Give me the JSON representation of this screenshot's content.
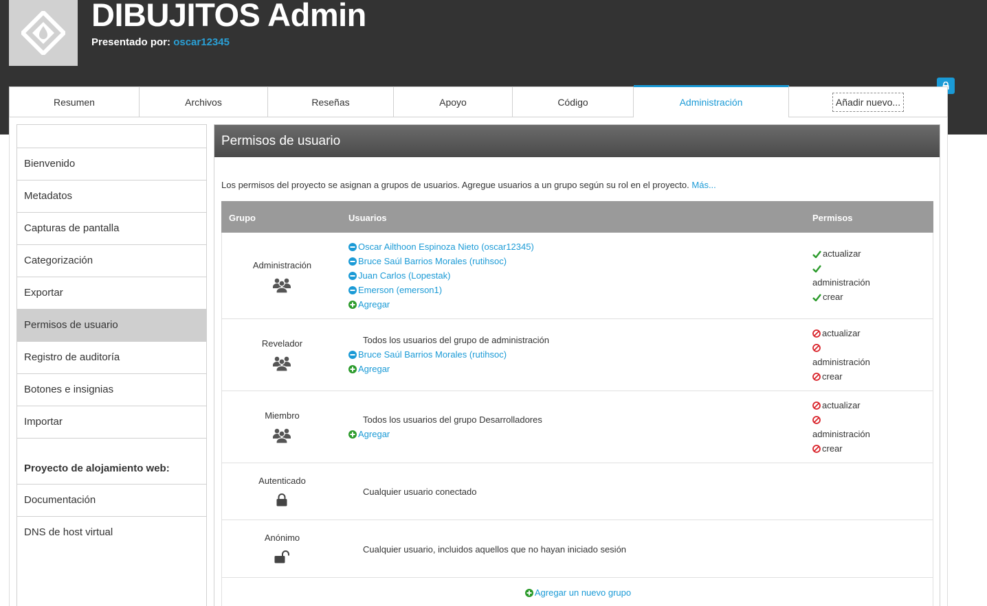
{
  "header": {
    "title": "DIBUJITOS Admin",
    "byline_label": "Presentado por:",
    "byline_user": "oscar12345"
  },
  "tabs": [
    {
      "label": "Resumen"
    },
    {
      "label": "Archivos"
    },
    {
      "label": "Reseñas"
    },
    {
      "label": "Apoyo"
    },
    {
      "label": "Código"
    },
    {
      "label": "Administración"
    },
    {
      "label": "Añadir nuevo..."
    }
  ],
  "sidebar": {
    "items": [
      {
        "label": "Bienvenido"
      },
      {
        "label": "Metadatos"
      },
      {
        "label": "Capturas de pantalla"
      },
      {
        "label": "Categorización"
      },
      {
        "label": "Exportar"
      },
      {
        "label": "Permisos de usuario"
      },
      {
        "label": "Registro de auditoría"
      },
      {
        "label": "Botones e insignias"
      },
      {
        "label": "Importar"
      }
    ],
    "section_heading": "Proyecto de alojamiento web:",
    "section_items": [
      {
        "label": "Documentación"
      },
      {
        "label": "DNS de host virtual"
      }
    ]
  },
  "main": {
    "title": "Permisos de usuario",
    "intro": "Los permisos del proyecto se asignan a grupos de usuarios. Agregue usuarios a un grupo según su rol en el proyecto.",
    "intro_link": "Más...",
    "columns": {
      "group": "Grupo",
      "users": "Usuarios",
      "perms": "Permisos"
    },
    "add_label": "Agregar",
    "perm_labels": {
      "update": "actualizar",
      "admin": "administración",
      "create": "crear"
    },
    "groups": [
      {
        "name": "Administración",
        "users": [
          "Oscar Ailthoon Espinoza Nieto (oscar12345)",
          "Bruce Saúl Barrios Morales (rutihsoc)",
          "Juan Carlos (Lopestak)",
          "Emerson (emerson1)"
        ]
      },
      {
        "name": "Revelador",
        "note": "Todos los usuarios del grupo de administración",
        "users": [
          "Bruce Saúl Barrios Morales (rutihsoc)"
        ]
      },
      {
        "name": "Miembro",
        "note": "Todos los usuarios del grupo Desarrolladores"
      },
      {
        "name": "Autenticado",
        "note": "Cualquier usuario conectado"
      },
      {
        "name": "Anónimo",
        "note": "Cualquier usuario, incluidos aquellos que no hayan iniciado sesión"
      }
    ],
    "add_group_label": "Agregar un nuevo grupo"
  },
  "colors": {
    "accent": "#1a9ad6",
    "header_bg": "#333333",
    "allowed": "#2a9a2a",
    "denied": "#d9232a"
  }
}
